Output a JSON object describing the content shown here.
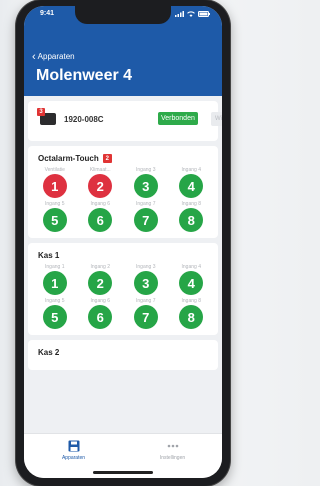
{
  "status": {
    "time": "9:41"
  },
  "nav": {
    "back_label": "Apparaten",
    "title": "Molenweer 4"
  },
  "device": {
    "badge": "3",
    "name": "1920-008C",
    "status_label": "Verbonden",
    "wifi_label": "Wifi"
  },
  "sections": [
    {
      "title": "Octalarm-Touch",
      "badge": "2",
      "items": [
        {
          "label": "Ventilatie",
          "number": "1",
          "state": "alarm"
        },
        {
          "label": "Klimaat...",
          "number": "2",
          "state": "alarm"
        },
        {
          "label": "Ingang 3",
          "number": "3",
          "state": "ok"
        },
        {
          "label": "Ingang 4",
          "number": "4",
          "state": "ok"
        },
        {
          "label": "Ingang 5",
          "number": "5",
          "state": "ok"
        },
        {
          "label": "Ingang 6",
          "number": "6",
          "state": "ok"
        },
        {
          "label": "Ingang 7",
          "number": "7",
          "state": "ok"
        },
        {
          "label": "Ingang 8",
          "number": "8",
          "state": "ok"
        }
      ]
    },
    {
      "title": "Kas 1",
      "badge": "",
      "items": [
        {
          "label": "Ingang 1",
          "number": "1",
          "state": "ok"
        },
        {
          "label": "Ingang 2",
          "number": "2",
          "state": "ok"
        },
        {
          "label": "Ingang 3",
          "number": "3",
          "state": "ok"
        },
        {
          "label": "Ingang 4",
          "number": "4",
          "state": "ok"
        },
        {
          "label": "Ingang 5",
          "number": "5",
          "state": "ok"
        },
        {
          "label": "Ingang 6",
          "number": "6",
          "state": "ok"
        },
        {
          "label": "Ingang 7",
          "number": "7",
          "state": "ok"
        },
        {
          "label": "Ingang 8",
          "number": "8",
          "state": "ok"
        }
      ]
    },
    {
      "title": "Kas 2",
      "badge": "",
      "items": []
    }
  ],
  "tabbar": {
    "tabs": [
      {
        "label": "Apparaten",
        "icon": "save-icon",
        "active": true
      },
      {
        "label": "Instellingen",
        "icon": "more-icon",
        "active": false
      }
    ]
  },
  "colors": {
    "header": "#1e5aa8",
    "ok": "#26a547",
    "alarm": "#de3140",
    "connected": "#2eaa4a",
    "badge": "#e03434"
  }
}
